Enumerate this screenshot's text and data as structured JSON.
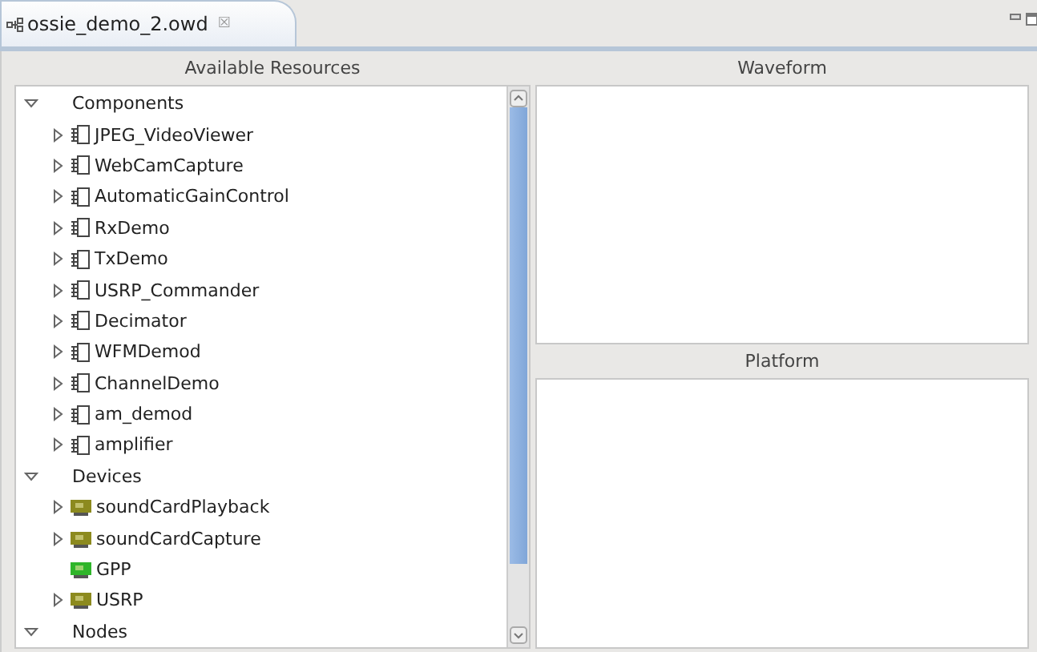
{
  "editor_tab": {
    "title": "ossie_demo_2.owd",
    "close": "☒"
  },
  "resources": {
    "title": "Available Resources",
    "tree": [
      {
        "label": "Components",
        "kind": "category",
        "expanded": true,
        "children": [
          {
            "label": "JPEG_VideoViewer",
            "kind": "component",
            "expandable": true
          },
          {
            "label": "WebCamCapture",
            "kind": "component",
            "expandable": true
          },
          {
            "label": "AutomaticGainControl",
            "kind": "component",
            "expandable": true
          },
          {
            "label": "RxDemo",
            "kind": "component",
            "expandable": true
          },
          {
            "label": "TxDemo",
            "kind": "component",
            "expandable": true
          },
          {
            "label": "USRP_Commander",
            "kind": "component",
            "expandable": true
          },
          {
            "label": "Decimator",
            "kind": "component",
            "expandable": true
          },
          {
            "label": "WFMDemod",
            "kind": "component",
            "expandable": true
          },
          {
            "label": "ChannelDemo",
            "kind": "component",
            "expandable": true
          },
          {
            "label": "am_demod",
            "kind": "component",
            "expandable": true
          },
          {
            "label": "amplifier",
            "kind": "component",
            "expandable": true
          }
        ]
      },
      {
        "label": "Devices",
        "kind": "category",
        "expanded": true,
        "children": [
          {
            "label": "soundCardPlayback",
            "kind": "device",
            "color": "#8c8a1e",
            "expandable": true
          },
          {
            "label": "soundCardCapture",
            "kind": "device",
            "color": "#8c8a1e",
            "expandable": true
          },
          {
            "label": "GPP",
            "kind": "device",
            "color": "#2fb52a",
            "expandable": false
          },
          {
            "label": "USRP",
            "kind": "device",
            "color": "#8c8a1e",
            "expandable": true
          }
        ]
      },
      {
        "label": "Nodes",
        "kind": "category",
        "expanded": true
      }
    ]
  },
  "waveform": {
    "title": "Waveform"
  },
  "platform": {
    "title": "Platform"
  }
}
